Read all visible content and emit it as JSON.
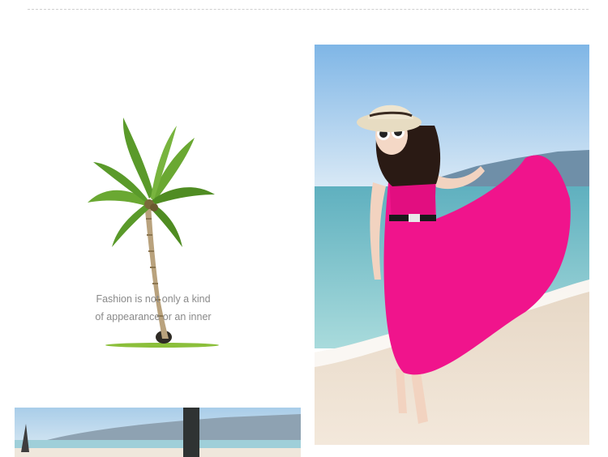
{
  "tagline": {
    "line1": "Fashion is not only a kind",
    "line2": "of appearance or an inner"
  },
  "images": {
    "palm": "palm-tree-illustration",
    "model": "model-in-pink-dress-on-beach-photo",
    "beach": "beach-scene-photo"
  },
  "colors": {
    "dress": "#f0148c",
    "sky": "#a9d2ee",
    "sea": "#7fc3cf",
    "sand": "#efe2d2",
    "text": "#8a8a8a"
  }
}
